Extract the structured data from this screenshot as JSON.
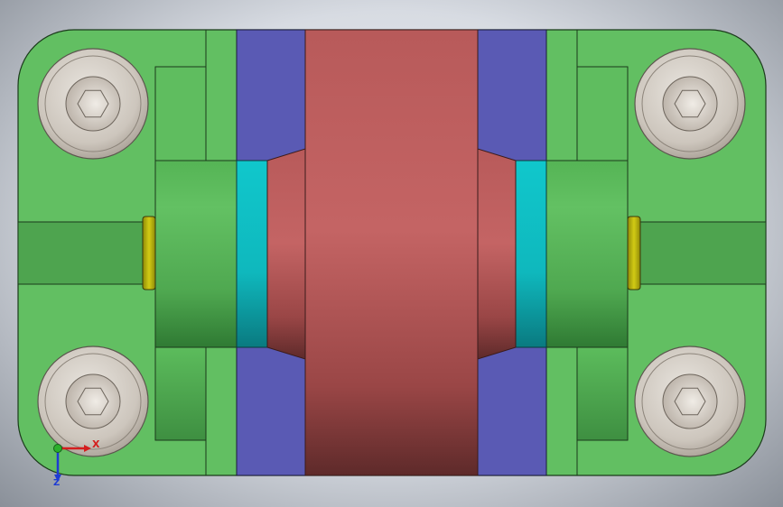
{
  "viewport": {
    "colors": {
      "plate": "#62bf62",
      "plate_shadow": "#4ea44f",
      "plate_edge": "#1b3a1b",
      "insert": "#5a5ab4",
      "roller_light": "#c46464",
      "roller_dark": "#5e2a2a",
      "ring": "#0fc4c9",
      "shim": "#c9c20c",
      "bolt_head": "#d2ccc4"
    }
  },
  "triad": {
    "x_label": "X",
    "z_label": "Z",
    "x_color": "#d41e1e",
    "y_color": "#2bb02b",
    "z_color": "#1e3cd4"
  }
}
